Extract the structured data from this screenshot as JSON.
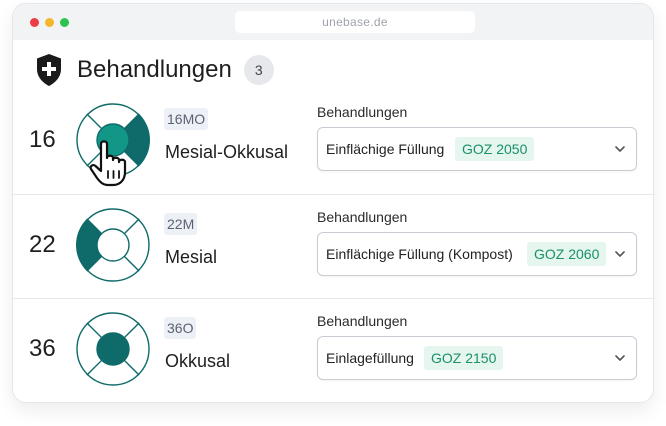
{
  "browser": {
    "url": "unebase.de",
    "controls": [
      {
        "name": "close-dot",
        "color": "#ec3c44"
      },
      {
        "name": "minimize-dot",
        "color": "#f4b72b"
      },
      {
        "name": "maximize-dot",
        "color": "#2dc44e"
      }
    ]
  },
  "header": {
    "icon": "shield-plus-icon",
    "title": "Behandlungen",
    "count": "3"
  },
  "colors": {
    "accent_dark": "#0f6b6a",
    "accent": "#129787",
    "tag_bg": "#e4f6ee",
    "tag_text": "#1b8f6a"
  },
  "rows": [
    {
      "tooth": "16",
      "code": "16MO",
      "surface": "Mesial-Okkusal",
      "field_label": "Behandlungen",
      "selected": "Einflächige Füllung",
      "goz": "GOZ 2050"
    },
    {
      "tooth": "22",
      "code": "22M",
      "surface": "Mesial",
      "field_label": "Behandlungen",
      "selected": "Einflächige Füllung (Kompost)",
      "goz": "GOZ 2060"
    },
    {
      "tooth": "36",
      "code": "36O",
      "surface": "Okkusal",
      "field_label": "Behandlungen",
      "selected": "Einlagefüllung",
      "goz": "GOZ 2150"
    }
  ]
}
